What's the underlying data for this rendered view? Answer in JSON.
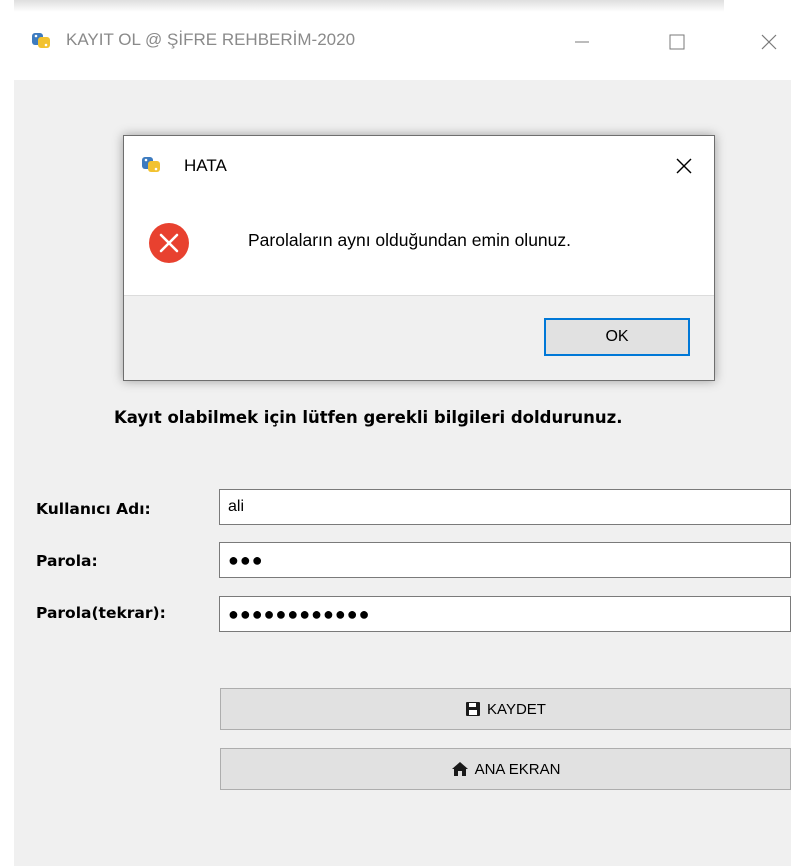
{
  "window": {
    "title": "KAYIT OL @ ŞİFRE REHBERİM-2020",
    "icon": "python-app-icon",
    "controls": [
      "—",
      "☐",
      "✕"
    ]
  },
  "form": {
    "heading": "Kayıt olabilmek için lütfen gerekli bilgileri doldurunuz.",
    "username_label": "Kullanıcı Adı:",
    "username_value": "ali",
    "password_label": "Parola:",
    "password_value": "●●●",
    "password_repeat_label": "Parola(tekrar):",
    "password_repeat_value": "●●●●●●●●●●●●",
    "save_label": "KAYDET",
    "save_icon": "floppy-disk-icon",
    "home_label": "ANA EKRAN",
    "home_icon": "home-icon"
  },
  "dialog": {
    "title": "HATA",
    "icon": "error-icon",
    "message": "Parolaların aynı olduğundan emin olunuz.",
    "ok_label": "OK",
    "close": "✕"
  },
  "colors": {
    "accent": "#0078d7",
    "error": "#e8412f",
    "window_bg": "#f0f0f0"
  }
}
